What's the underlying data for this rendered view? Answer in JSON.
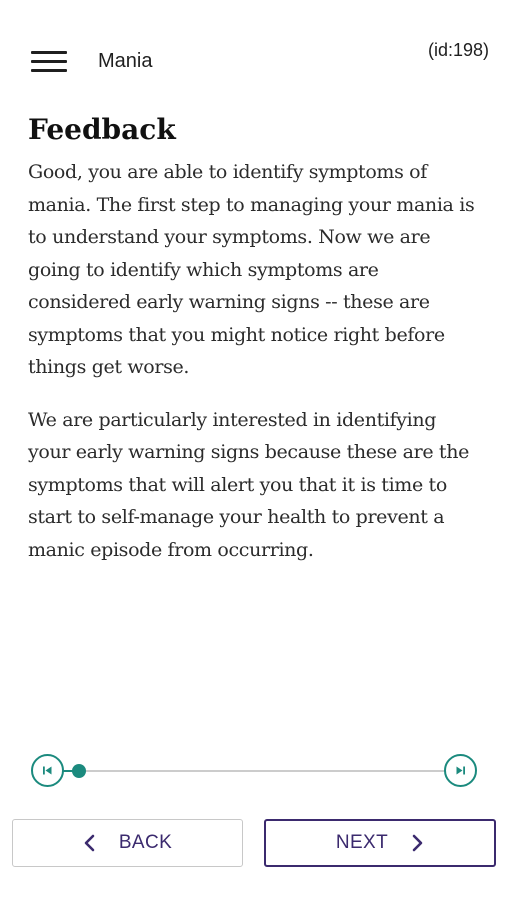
{
  "header": {
    "title": "Mania",
    "page_id": "(id:198)",
    "menu_icon": "hamburger-menu-icon"
  },
  "main": {
    "heading": "Feedback",
    "paragraphs": [
      "Good, you are able to identify symptoms of mania. The first step to managing your mania is to understand your symptoms. Now we are going to identify which symptoms are considered early warning signs -- these are symptoms that you might notice right before things get worse.",
      "We are particularly interested in identifying your early warning signs because these are the symptoms that will alert you that it is time to start to self-manage your health to prevent a manic episode from occurring."
    ]
  },
  "progress": {
    "value": 0.077,
    "first_icon": "skip-to-start-icon",
    "last_icon": "skip-to-end-icon"
  },
  "footer": {
    "back_label": "BACK",
    "next_label": "NEXT",
    "back_icon": "chevron-left-icon",
    "next_icon": "chevron-right-icon"
  },
  "colors": {
    "accent": "#1b8a7e",
    "primary_text": "#3b2a6e",
    "body_text": "#2b2b2b",
    "track": "#cccccc"
  }
}
